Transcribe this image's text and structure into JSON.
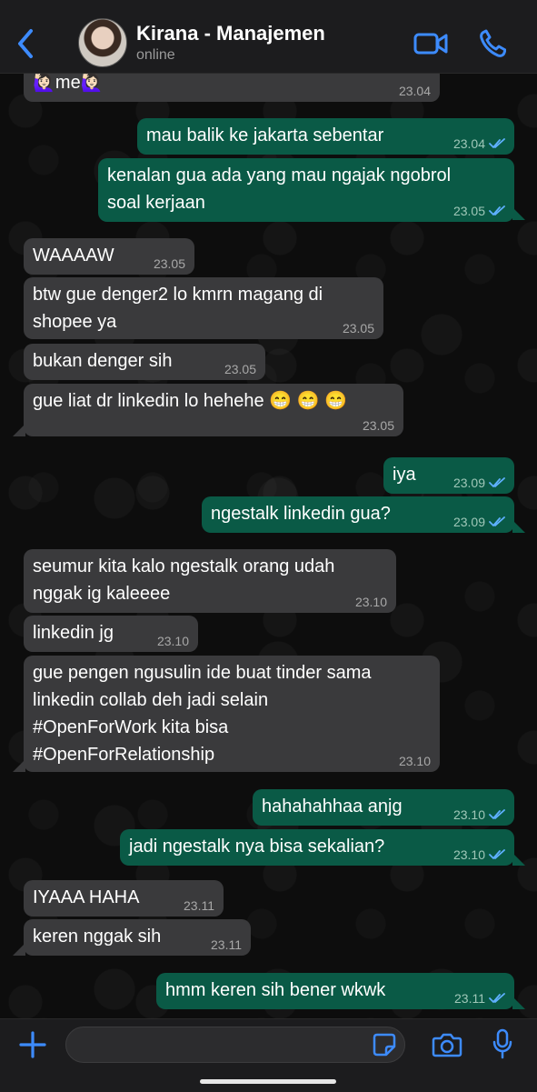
{
  "header": {
    "title": "Kirana - Manajemen",
    "status": "online"
  },
  "colors": {
    "incoming_bubble": "#3a3a3c",
    "outgoing_bubble": "#0a5a46",
    "accent": "#3d8bfd",
    "read_tick": "#5fb0ff"
  },
  "messages": [
    {
      "dir": "in",
      "text": "🙋🏻‍♀️me🙋🏻‍♀️",
      "time": "23.04"
    },
    {
      "dir": "out",
      "text": "mau balik ke jakarta sebentar",
      "time": "23.04",
      "read": true
    },
    {
      "dir": "out",
      "text": "kenalan gua ada yang mau ngajak ngobrol\nsoal kerjaan",
      "time": "23.05",
      "read": true
    },
    {
      "dir": "in",
      "text": "WAAAAW",
      "time": "23.05"
    },
    {
      "dir": "in",
      "text": "btw gue denger2 lo kmrn magang di\nshopee ya",
      "time": "23.05"
    },
    {
      "dir": "in",
      "text": "bukan denger sih",
      "time": "23.05"
    },
    {
      "dir": "in",
      "text": "gue liat dr linkedin lo hehehe 😁 😁 😁",
      "time": "23.05"
    },
    {
      "dir": "out",
      "text": "iya",
      "time": "23.09",
      "read": true
    },
    {
      "dir": "out",
      "text": "ngestalk linkedin gua?",
      "time": "23.09",
      "read": true
    },
    {
      "dir": "in",
      "text": "seumur kita kalo ngestalk orang udah\nnggak ig kaleeee",
      "time": "23.10"
    },
    {
      "dir": "in",
      "text": "linkedin jg",
      "time": "23.10"
    },
    {
      "dir": "in",
      "text": "gue pengen ngusulin ide buat tinder sama\nlinkedin collab deh jadi selain\n#OpenForWork kita bisa\n#OpenForRelationship",
      "time": "23.10"
    },
    {
      "dir": "out",
      "text": "hahahahhaa anjg",
      "time": "23.10",
      "read": true
    },
    {
      "dir": "out",
      "text": "jadi ngestalk nya bisa sekalian?",
      "time": "23.10",
      "read": true
    },
    {
      "dir": "in",
      "text": "IYAAA HAHA",
      "time": "23.11"
    },
    {
      "dir": "in",
      "text": "keren nggak sih",
      "time": "23.11"
    },
    {
      "dir": "out",
      "text": "hmm keren sih bener wkwk",
      "time": "23.11",
      "read": true
    }
  ],
  "composer": {
    "value": "",
    "placeholder": ""
  },
  "icons": [
    "back-chevron-icon",
    "avatar",
    "video-call-icon",
    "phone-icon",
    "plus-icon",
    "sticker-icon",
    "camera-icon",
    "microphone-icon",
    "double-check-icon"
  ]
}
